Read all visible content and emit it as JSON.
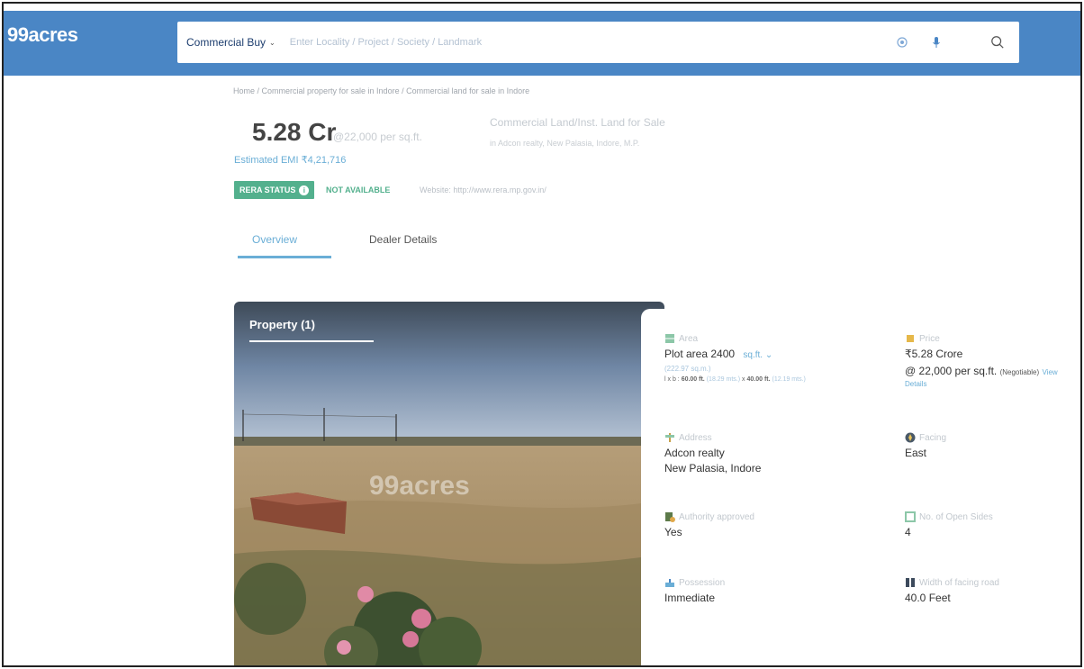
{
  "header": {
    "logo": "99acres",
    "search_type": "Commercial Buy",
    "search_placeholder": "Enter Locality / Project / Society / Landmark"
  },
  "breadcrumb": "Home / Commercial property for sale in Indore / Commercial land for sale in Indore",
  "summary": {
    "price": "5.28 Cr",
    "price_per_sqft": "@22,000 per sq.ft.",
    "emi": "Estimated EMI ₹4,21,716",
    "title": "Commercial Land/Inst. Land for Sale",
    "subtitle": "in Adcon realty, New Palasia, Indore, M.P.",
    "rera_badge": "RERA STATUS",
    "rera_value": "NOT AVAILABLE",
    "rera_website": "Website: http://www.rera.mp.gov.in/"
  },
  "tabs": {
    "overview": "Overview",
    "dealer": "Dealer Details"
  },
  "photo": {
    "label": "Property (1)",
    "watermark": "99acres"
  },
  "details": {
    "area": {
      "label": "Area",
      "value": "Plot area 2400",
      "unit": "sq.ft.",
      "converted": "(222.97 sq.m.)",
      "dims_prefix": "l x b :",
      "length": "60.00 ft.",
      "length_m": "(18.29 mts.)",
      "sep": "x",
      "breadth": "40.00 ft.",
      "breadth_m": "(12.19 mts.)"
    },
    "price": {
      "label": "Price",
      "value": "₹5.28 Crore",
      "per_sqft": "@ 22,000 per sq.ft.",
      "negotiable": "(Negotiable)",
      "view": "View",
      "details_link": "Details"
    },
    "address": {
      "label": "Address",
      "line1": "Adcon realty",
      "line2": "New Palasia, Indore"
    },
    "facing": {
      "label": "Facing",
      "value": "East"
    },
    "authority": {
      "label": "Authority approved",
      "value": "Yes"
    },
    "open_sides": {
      "label": "No. of Open Sides",
      "value": "4"
    },
    "possession": {
      "label": "Possession",
      "value": "Immediate"
    },
    "road": {
      "label": "Width of facing road",
      "value": "40.0 Feet"
    }
  }
}
